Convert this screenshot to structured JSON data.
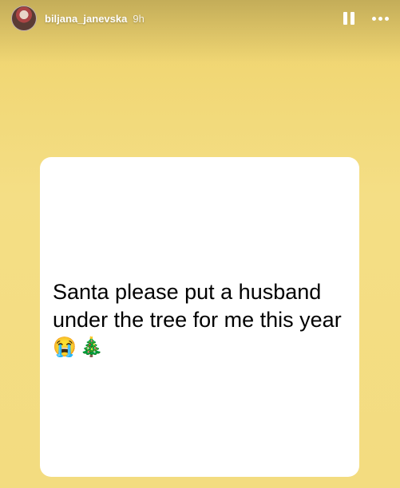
{
  "header": {
    "username": "biljana_janevska",
    "time": "9h"
  },
  "story": {
    "line1": "Santa please put a husband",
    "line2": "under the tree for me this year",
    "emoji1": "😭",
    "emoji2": "🎄"
  },
  "icons": {
    "pause": "pause-icon",
    "more": "more-icon"
  },
  "colors": {
    "background": "#f3dc80",
    "card": "#ffffff"
  }
}
